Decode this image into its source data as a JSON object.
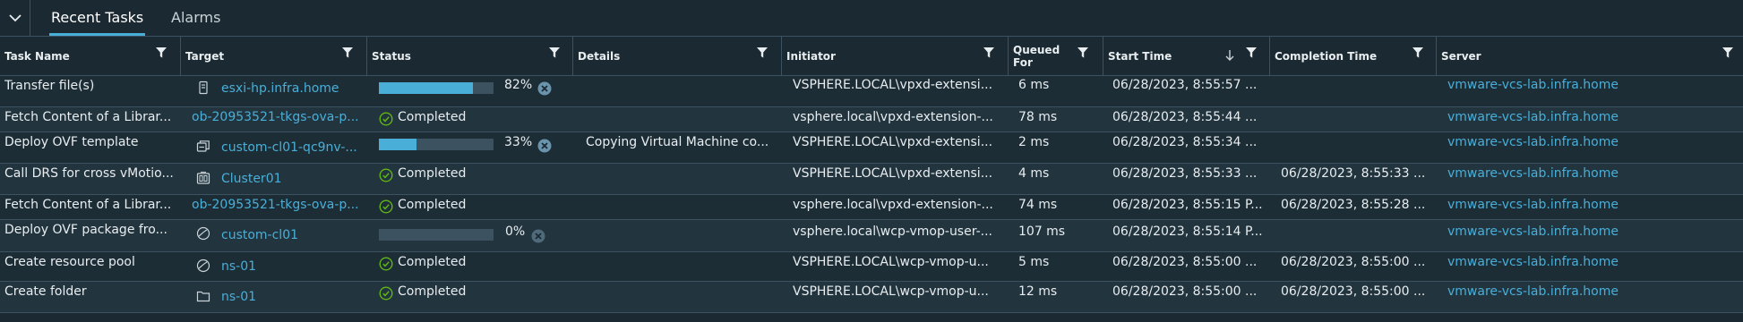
{
  "tabs": [
    {
      "label": "Recent Tasks"
    },
    {
      "label": "Alarms"
    }
  ],
  "columns": {
    "task_name": "Task Name",
    "target": "Target",
    "status": "Status",
    "details": "Details",
    "initiator": "Initiator",
    "queued_for_1": "Queued",
    "queued_for_2": "For",
    "start_time": "Start Time",
    "completion_time": "Completion Time",
    "server": "Server"
  },
  "rows": [
    {
      "task": "Transfer file(s)",
      "target": "esxi-hp.infra.home",
      "target_icon": "host-icon",
      "status": "82%",
      "progress": 0.82,
      "details": "",
      "initiator": "VSPHERE.LOCAL\\vpxd-extensi...",
      "queued": "6 ms",
      "start": "06/28/2023, 8:55:57 ...",
      "completion": "",
      "server": "vmware-vcs-lab.infra.home"
    },
    {
      "task": "Fetch Content of a Librar...",
      "target": "ob-20953521-tkgs-ova-p...",
      "status": "Completed",
      "details": "",
      "initiator": "vsphere.local\\vpxd-extension-...",
      "queued": "78 ms",
      "start": "06/28/2023, 8:55:44 ...",
      "completion": "",
      "server": "vmware-vcs-lab.infra.home"
    },
    {
      "task": "Deploy OVF template",
      "target": "custom-cl01-qc9nv-...",
      "target_icon": "vm-icon",
      "status": "33%",
      "progress": 0.33,
      "details": "Copying Virtual Machine co...",
      "initiator": "VSPHERE.LOCAL\\vpxd-extensi...",
      "queued": "2 ms",
      "start": "06/28/2023, 8:55:34 ...",
      "completion": "",
      "server": "vmware-vcs-lab.infra.home"
    },
    {
      "task": "Call DRS for cross vMotio...",
      "target": "Cluster01",
      "target_icon": "cluster-icon",
      "status": "Completed",
      "details": "",
      "initiator": "VSPHERE.LOCAL\\vpxd-extensi...",
      "queued": "4 ms",
      "start": "06/28/2023, 8:55:33 ...",
      "completion": "06/28/2023, 8:55:33 ...",
      "server": "vmware-vcs-lab.infra.home"
    },
    {
      "task": "Fetch Content of a Librar...",
      "target": "ob-20953521-tkgs-ova-p...",
      "status": "Completed",
      "details": "",
      "initiator": "vsphere.local\\vpxd-extension-...",
      "queued": "74 ms",
      "start": "06/28/2023, 8:55:15 P...",
      "completion": "06/28/2023, 8:55:28 ...",
      "server": "vmware-vcs-lab.infra.home"
    },
    {
      "task": "Deploy OVF package fro...",
      "target": "custom-cl01",
      "target_icon": "resource-pool-icon",
      "status": "0%",
      "progress": 0.0,
      "details": "",
      "initiator": "vsphere.local\\wcp-vmop-user-...",
      "queued": "107 ms",
      "start": "06/28/2023, 8:55:14 P...",
      "completion": "",
      "server": "vmware-vcs-lab.infra.home"
    },
    {
      "task": "Create resource pool",
      "target": "ns-01",
      "target_icon": "resource-pool-icon",
      "status": "Completed",
      "details": "",
      "initiator": "VSPHERE.LOCAL\\wcp-vmop-u...",
      "queued": "5 ms",
      "start": "06/28/2023, 8:55:00 ...",
      "completion": "06/28/2023, 8:55:00 ...",
      "server": "vmware-vcs-lab.infra.home"
    },
    {
      "task": "Create folder",
      "target": "ns-01",
      "target_icon": "folder-icon",
      "status": "Completed",
      "details": "",
      "initiator": "VSPHERE.LOCAL\\wcp-vmop-u...",
      "queued": "12 ms",
      "start": "06/28/2023, 8:55:00 ...",
      "completion": "06/28/2023, 8:55:00 ...",
      "server": "vmware-vcs-lab.infra.home"
    }
  ],
  "colors": {
    "accent": "#49afd9",
    "success": "#60b515",
    "cancel": "#6a94ad"
  }
}
